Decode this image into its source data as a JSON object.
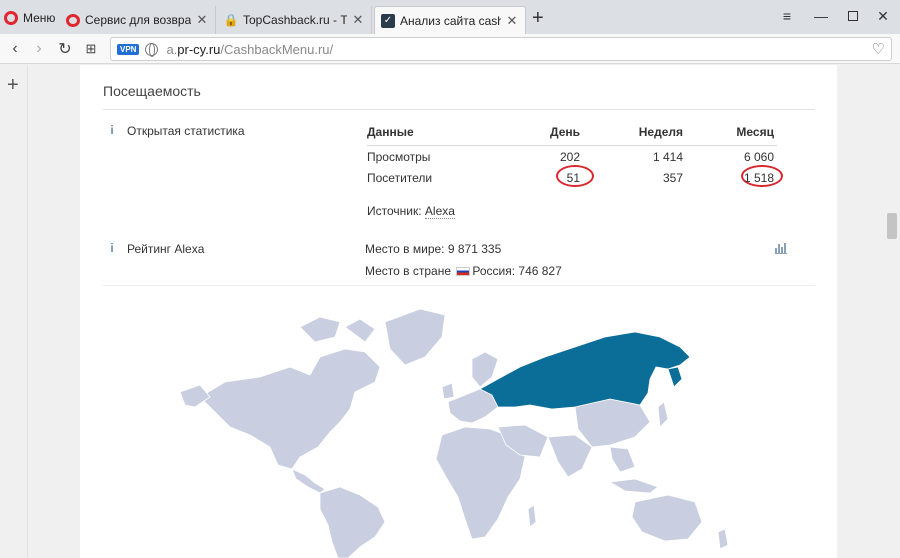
{
  "browser": {
    "menu_label": "Меню",
    "tabs": [
      {
        "title": "Сервис для возврата кэш",
        "favicon": "opera-icon",
        "active": false
      },
      {
        "title": "TopCashback.ru - Топ луч",
        "favicon": "lock-icon",
        "active": false
      },
      {
        "title": "Анализ сайта cashbackme",
        "favicon": "checkmark-icon",
        "active": true
      }
    ],
    "new_tab_label": "+",
    "window_controls": [
      "menu-icon",
      "minimize-icon",
      "maximize-icon",
      "close-icon"
    ]
  },
  "address_bar": {
    "vpn_label": "VPN",
    "url_prefix": "a.",
    "url_host": "pr-cy.ru",
    "url_path": "/CashbackMenu.ru/"
  },
  "page": {
    "section_title": "Посещаемость",
    "open_stats": {
      "label": "Открытая статистика",
      "columns": [
        "Данные",
        "День",
        "Неделя",
        "Месяц"
      ],
      "rows": [
        {
          "label": "Просмотры",
          "day": "202",
          "week": "1 414",
          "month": "6 060"
        },
        {
          "label": "Посетители",
          "day": "51",
          "week": "357",
          "month": "1 518"
        }
      ],
      "highlighted_values": [
        "51",
        "1 518"
      ],
      "highlight_color": "#d9262c",
      "source_prefix": "Источник:",
      "source_link": "Alexa"
    },
    "alexa_rating": {
      "label": "Рейтинг Alexa",
      "world_rank_text": "Место в мире: 9 871 335",
      "country_rank_prefix": "Место в стране",
      "country_rank_value": "Россия: 746 827",
      "chart_icon": "bar-chart-icon"
    },
    "map": {
      "highlighted_country": "Россия",
      "highlight_color": "#0a6e99",
      "land_color": "#c9cfe0"
    }
  },
  "colors": {
    "accent": "#e0262f",
    "info_icon": "#6a8fb3"
  }
}
